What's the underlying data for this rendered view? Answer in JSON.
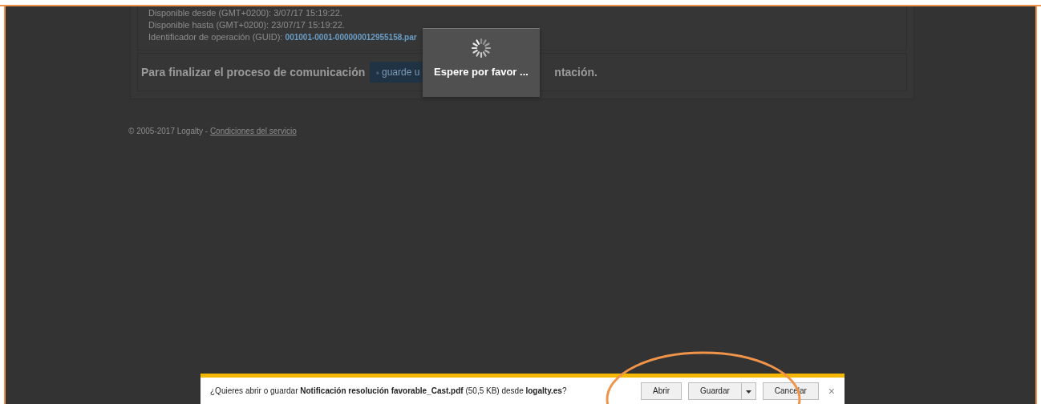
{
  "details": [
    {
      "kind": "text",
      "label": "Disponible desde (GMT+0200): 3/07/17 15:19:22."
    },
    {
      "kind": "text",
      "label": "Disponible hasta (GMT+0200): 23/07/17 15:19:22."
    },
    {
      "kind": "guid",
      "label": "Identificador de operación (GUID):",
      "value": "001001-0001-000000012955158.par"
    }
  ],
  "finalize": {
    "lead": "Para finalizar el proceso de comunicación",
    "button": "guarde u",
    "tail": "ntación."
  },
  "loading": {
    "message": "Espere por favor ..."
  },
  "footer": {
    "copyright": "© 2005-2017 Logalty -",
    "link": "Condiciones del servicio"
  },
  "download_bar": {
    "message": "¿Quieres abrir o guardar **Notificación resolución favorable_Cast.pdf** (50,5 KB) desde **logalty.es**?",
    "buttons": [
      {
        "kind": "plain",
        "label": "Abrir"
      },
      {
        "kind": "split",
        "label": "Guardar"
      },
      {
        "kind": "plain",
        "label": "Cancelar"
      }
    ],
    "close": "×"
  }
}
